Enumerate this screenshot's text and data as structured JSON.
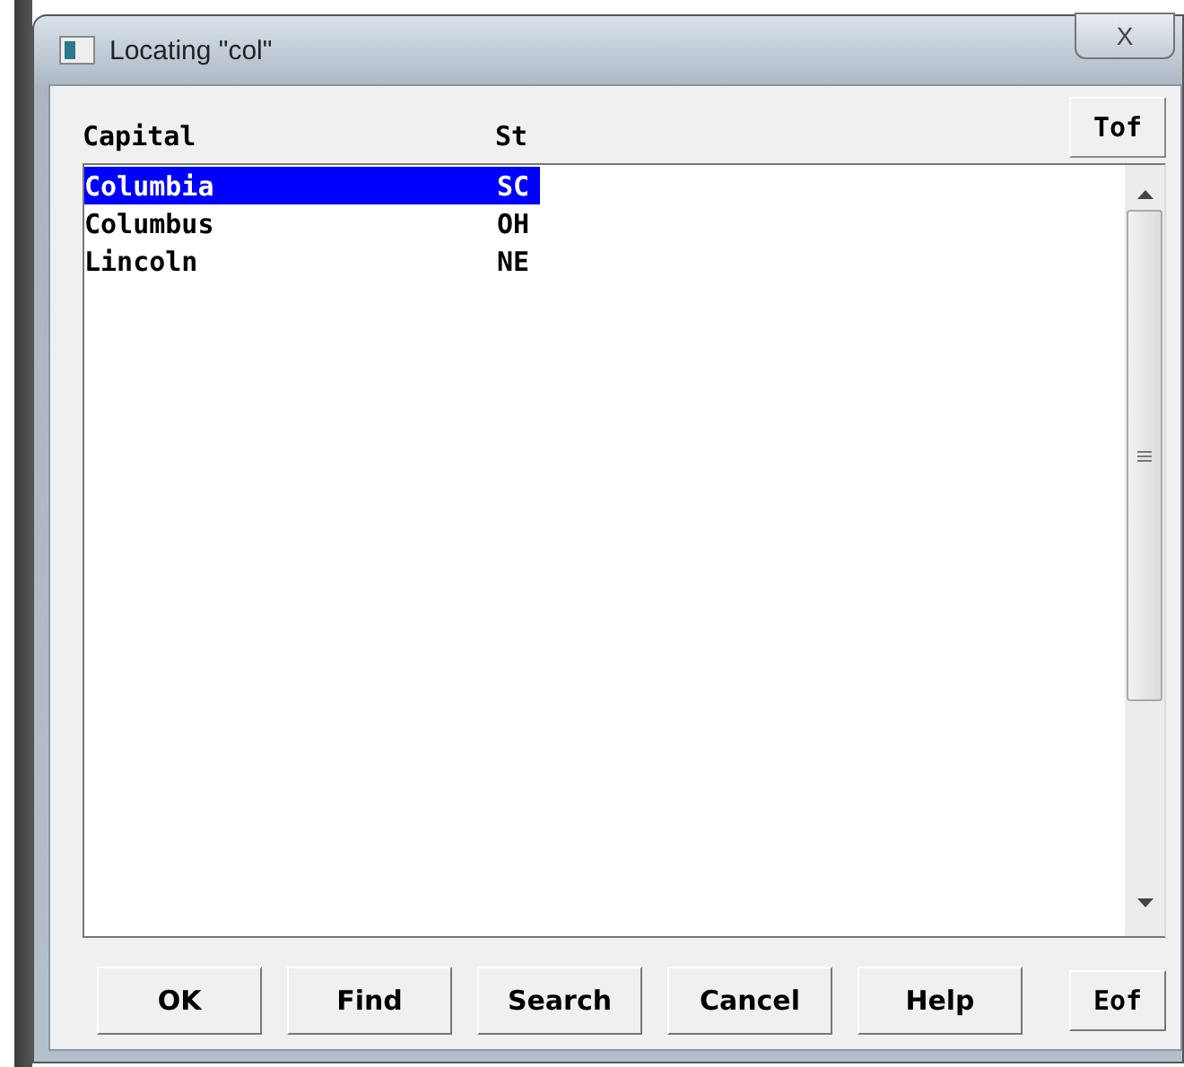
{
  "window": {
    "title": "Locating \"col\"",
    "close": "X"
  },
  "columns": [
    "Capital",
    "St"
  ],
  "top_button": "Tof",
  "rows": [
    {
      "capital": "Columbia",
      "state": "SC",
      "selected": true
    },
    {
      "capital": "Columbus",
      "state": "OH",
      "selected": false
    },
    {
      "capital": "Lincoln",
      "state": "NE",
      "selected": false
    }
  ],
  "buttons": [
    "OK",
    "Find",
    "Search",
    "Cancel",
    "Help"
  ],
  "end_button": "Eof"
}
